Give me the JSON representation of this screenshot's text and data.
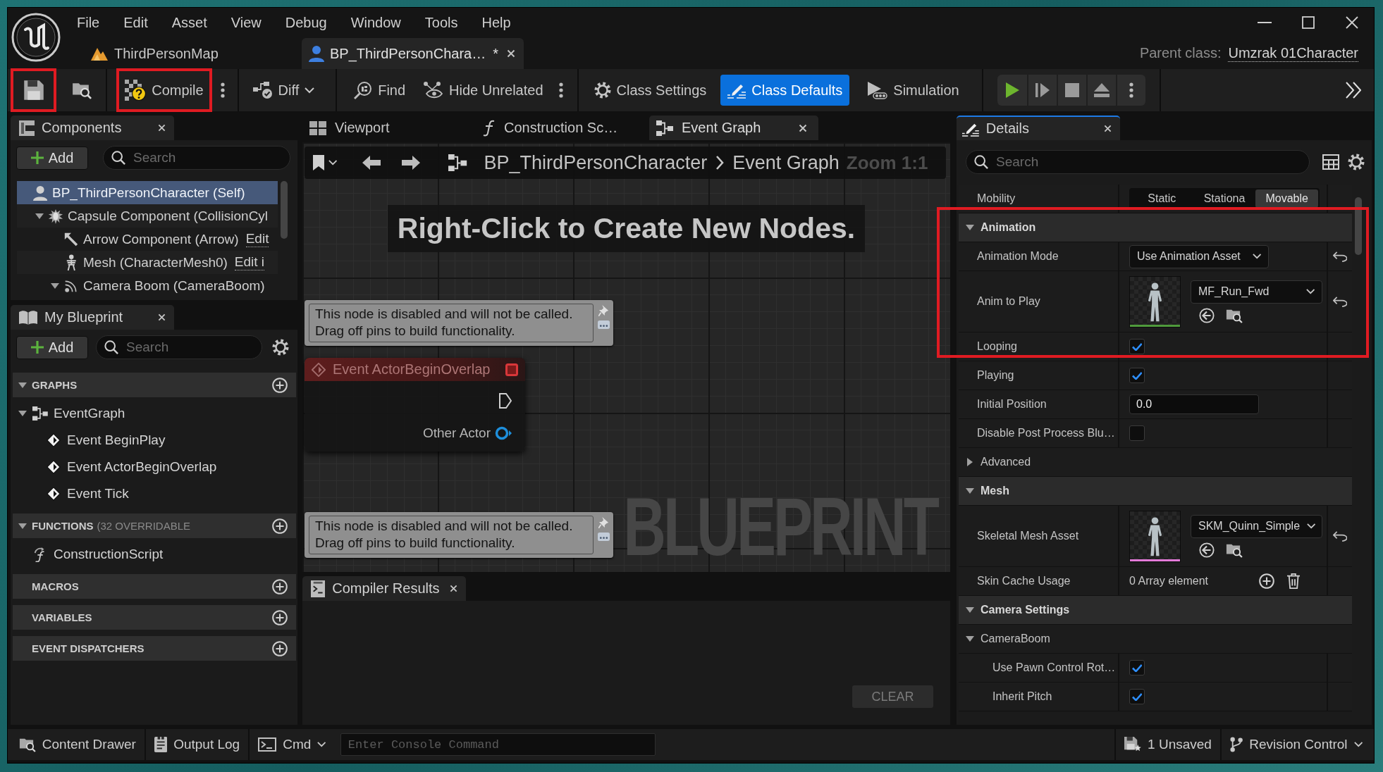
{
  "window": {
    "menu": [
      "File",
      "Edit",
      "Asset",
      "View",
      "Debug",
      "Window",
      "Tools",
      "Help"
    ],
    "tabs": [
      {
        "label": "ThirdPersonMap",
        "kind": "level",
        "selected": false
      },
      {
        "label": "BP_ThirdPersonChara…",
        "dirty_mark": "*",
        "kind": "blueprint",
        "selected": true
      }
    ],
    "parent_class_label": "Parent class:",
    "parent_class": "Umzrak 01Character"
  },
  "toolbar": {
    "save": {
      "highlighted": true
    },
    "compile": {
      "label": "Compile",
      "highlighted": true
    },
    "diff": {
      "label": "Diff"
    },
    "find": {
      "label": "Find"
    },
    "hide_unrelated": {
      "label": "Hide Unrelated"
    },
    "class_settings": {
      "label": "Class Settings",
      "selected": false
    },
    "class_defaults": {
      "label": "Class Defaults",
      "selected": true
    },
    "simulation": {
      "label": "Simulation"
    }
  },
  "components": {
    "title": "Components",
    "focused": false,
    "add_label": "Add",
    "search": {
      "placeholder": "Search"
    },
    "tree": [
      {
        "label": "BP_ThirdPersonCharacter (Self)",
        "kind": "self",
        "selected": true,
        "children": [
          {
            "label": "Capsule Component (CollisionCyl",
            "kind": "capsule",
            "selected": false,
            "expanded": true,
            "children": [
              {
                "label": "Arrow Component (Arrow)",
                "kind": "arrow",
                "link": "Edit",
                "selected": false
              },
              {
                "label": "Mesh (CharacterMesh0)",
                "kind": "mesh",
                "link": "Edit i",
                "selected": false
              },
              {
                "label": "Camera Boom (CameraBoom)",
                "kind": "boom",
                "selected": false,
                "expanded": true
              }
            ]
          }
        ]
      }
    ]
  },
  "my_blueprint": {
    "title": "My Blueprint",
    "focused": false,
    "add_label": "Add",
    "search": {
      "placeholder": "Search"
    },
    "sections": [
      {
        "title": "GRAPHS",
        "expanded": true,
        "items": [
          {
            "label": "EventGraph",
            "kind": "graph",
            "selected": false,
            "expanded": true,
            "children": [
              {
                "label": "Event BeginPlay",
                "kind": "event",
                "selected": false
              },
              {
                "label": "Event ActorBeginOverlap",
                "kind": "event",
                "selected": false
              },
              {
                "label": "Event Tick",
                "kind": "event",
                "selected": false
              }
            ]
          }
        ]
      },
      {
        "title": "FUNCTIONS",
        "note": "(32 OVERRIDABLE",
        "expanded": true,
        "items": [
          {
            "label": "ConstructionScript",
            "kind": "function",
            "selected": false
          }
        ]
      },
      {
        "title": "MACROS"
      },
      {
        "title": "VARIABLES"
      },
      {
        "title": "EVENT DISPATCHERS"
      }
    ]
  },
  "graph_editor": {
    "tabs": [
      {
        "label": "Viewport",
        "kind": "viewport",
        "selected": false
      },
      {
        "label": "Construction Sc…",
        "kind": "function",
        "selected": false
      },
      {
        "label": "Event Graph",
        "kind": "graph",
        "selected": true
      }
    ],
    "breadcrumb": [
      "BP_ThirdPersonCharacter",
      "Event Graph"
    ],
    "zoom_label": "Zoom 1:1",
    "hint": "Right-Click to Create New Nodes.",
    "nodes": [
      {
        "kind": "comment",
        "text": "This node is disabled and will not be called.\nDrag off pins to build functionality."
      },
      {
        "kind": "event",
        "title": "Event ActorBeginOverlap",
        "pins": [
          {
            "kind": "exec"
          },
          {
            "kind": "object",
            "label": "Other Actor"
          }
        ]
      },
      {
        "kind": "comment",
        "text": "This node is disabled and will not be called.\nDrag off pins to build functionality."
      }
    ],
    "graph_label": "BLUEPRINT"
  },
  "compiler_results": {
    "title": "Compiler Results",
    "focused": false,
    "clear_label": "CLEAR",
    "clear_disabled": true
  },
  "details": {
    "title": "Details",
    "focused": true,
    "search": {
      "placeholder": "Search"
    },
    "sections": [
      {
        "highlighted": false,
        "rows": [
          {
            "kind": "segmented",
            "label": "Mobility",
            "modified": false,
            "options": [
              {
                "label": "Static",
                "selected": false
              },
              {
                "label": "Stationa",
                "selected": false
              },
              {
                "label": "Movable",
                "selected": true
              }
            ]
          }
        ]
      },
      {
        "title": "Animation",
        "expanded": true,
        "highlighted": true,
        "rows": [
          {
            "kind": "dropdown",
            "label": "Animation Mode",
            "value": "Use Animation Asset",
            "modified": true
          },
          {
            "kind": "asset",
            "label": "Anim to Play",
            "value": "MF_Run_Fwd",
            "color": "#4f9a3c",
            "modified": true
          },
          {
            "kind": "checkbox",
            "label": "Looping",
            "checked": true,
            "modified": false
          },
          {
            "kind": "checkbox",
            "label": "Playing",
            "checked": true,
            "modified": false
          },
          {
            "kind": "number",
            "label": "Initial Position",
            "value": "0.0",
            "modified": false
          },
          {
            "kind": "checkbox",
            "label": "Disable Post Process Blu…",
            "checked": false,
            "modified": false
          },
          {
            "kind": "group",
            "label": "Advanced",
            "expanded": false
          }
        ]
      },
      {
        "title": "Mesh",
        "expanded": true,
        "highlighted": false,
        "rows": [
          {
            "kind": "asset",
            "label": "Skeletal Mesh Asset",
            "value": "SKM_Quinn_Simple",
            "color": "#e37ad8",
            "modified": true
          },
          {
            "kind": "array",
            "label": "Skin Cache Usage",
            "value": "0 Array element",
            "modified": false
          }
        ]
      },
      {
        "title": "Camera Settings",
        "expanded": true,
        "highlighted": false,
        "rows": [
          {
            "kind": "group",
            "label": "CameraBoom",
            "expanded": true,
            "children": [
              {
                "kind": "checkbox",
                "label": "Use Pawn Control Rot…",
                "checked": true,
                "modified": false
              },
              {
                "kind": "checkbox",
                "label": "Inherit Pitch",
                "checked": true,
                "modified": false
              }
            ]
          }
        ]
      }
    ]
  },
  "status_bar": {
    "content_drawer": "Content Drawer",
    "output_log": "Output Log",
    "cmd": "Cmd",
    "console": {
      "placeholder": "Enter Console Command"
    },
    "unsaved": "1 Unsaved",
    "revision_control": "Revision Control"
  }
}
